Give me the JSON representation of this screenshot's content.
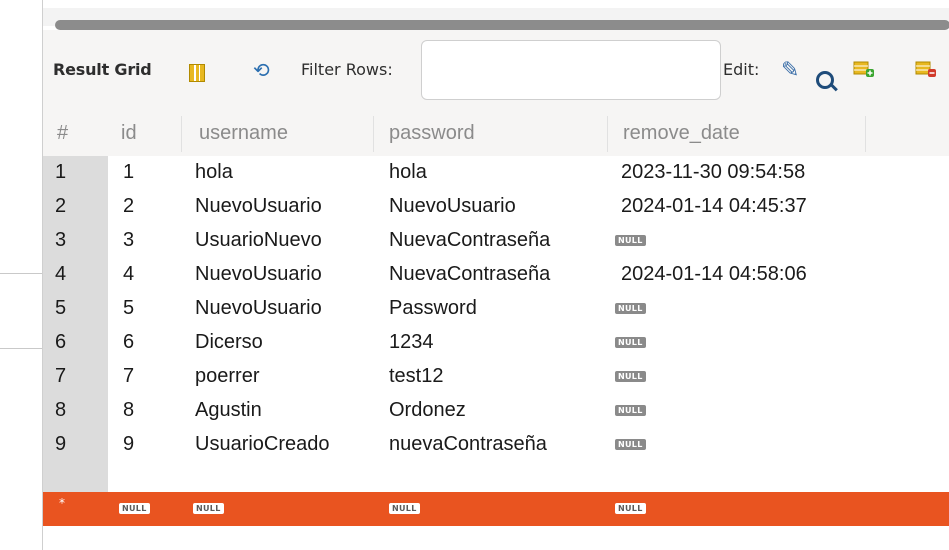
{
  "toolbar": {
    "title": "Result Grid",
    "filter_label": "Filter Rows:",
    "search_value": "",
    "edit_label": "Edit:"
  },
  "columns": [
    "#",
    "id",
    "username",
    "password",
    "remove_date"
  ],
  "rows": [
    {
      "num": "1",
      "id": "1",
      "username": "hola",
      "password": "hola",
      "remove_date": "2023-11-30 09:54:58"
    },
    {
      "num": "2",
      "id": "2",
      "username": "NuevoUsuario",
      "password": "NuevoUsuario",
      "remove_date": "2024-01-14 04:45:37"
    },
    {
      "num": "3",
      "id": "3",
      "username": "UsuarioNuevo",
      "password": "NuevaContraseña",
      "remove_date": "NULL"
    },
    {
      "num": "4",
      "id": "4",
      "username": "NuevoUsuario",
      "password": "NuevaContraseña",
      "remove_date": "2024-01-14 04:58:06"
    },
    {
      "num": "5",
      "id": "5",
      "username": "NuevoUsuario",
      "password": "Password",
      "remove_date": "NULL"
    },
    {
      "num": "6",
      "id": "6",
      "username": "Dicerso",
      "password": "1234",
      "remove_date": "NULL"
    },
    {
      "num": "7",
      "id": "7",
      "username": "poerrer",
      "password": "test12",
      "remove_date": "NULL"
    },
    {
      "num": "8",
      "id": "8",
      "username": "Agustin",
      "password": "Ordonez",
      "remove_date": "NULL"
    },
    {
      "num": "9",
      "id": "9",
      "username": "UsuarioCreado",
      "password": "nuevaContraseña",
      "remove_date": "NULL"
    }
  ],
  "new_row": {
    "marker": "*",
    "id": "NULL",
    "username": "NULL",
    "password": "NULL",
    "remove_date": "NULL"
  },
  "colors": {
    "new_row": "#e95420",
    "null_badge": "#8a8a8a"
  }
}
